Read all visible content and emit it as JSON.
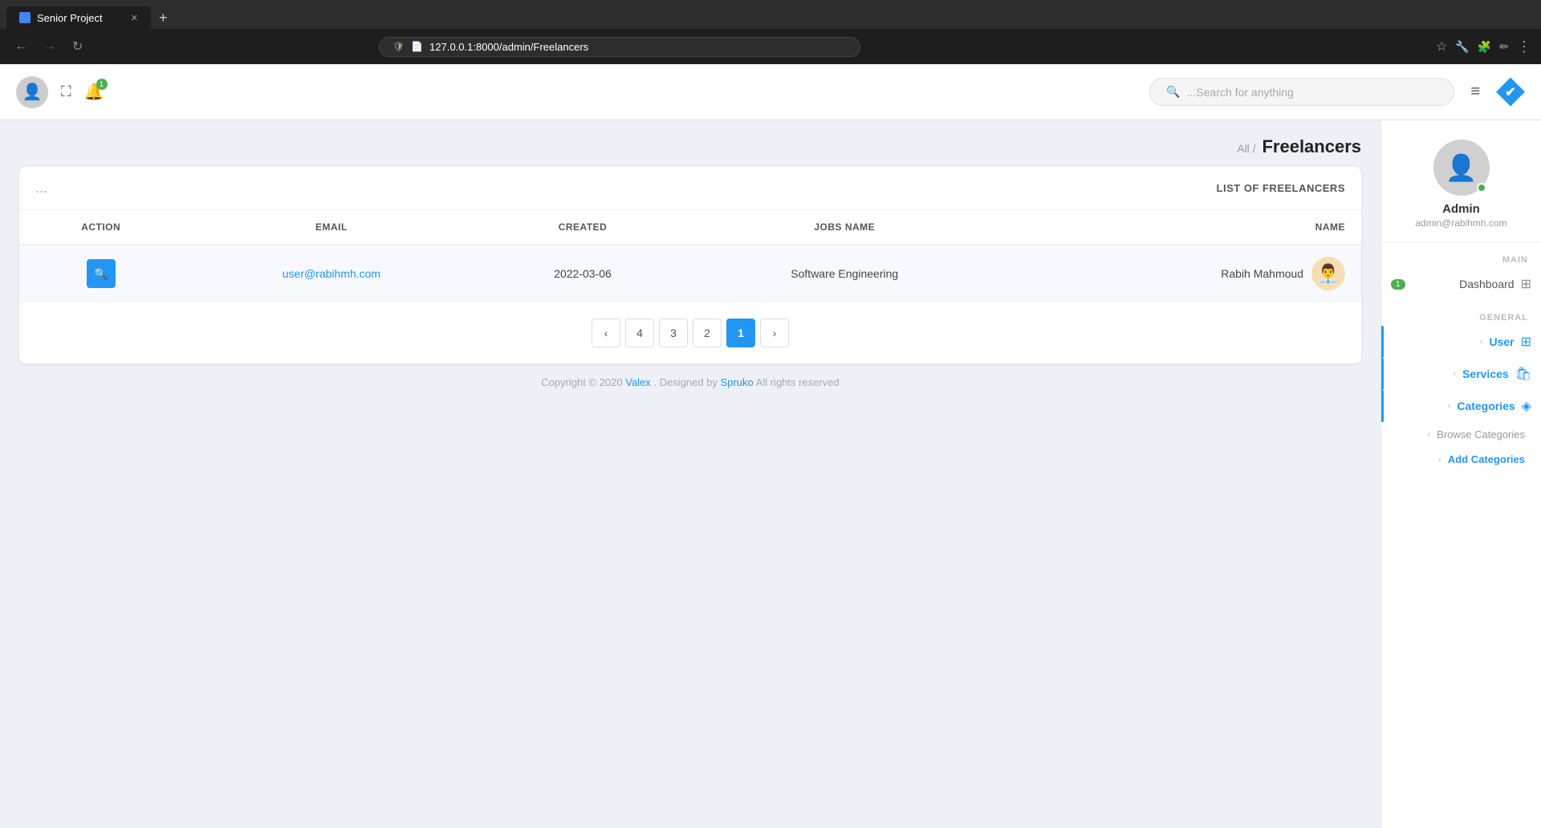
{
  "browser": {
    "tab_title": "Senior Project",
    "tab_favicon": "◆",
    "address": "127.0.0.1:8000/admin/Freelancers",
    "new_tab_label": "+"
  },
  "header": {
    "search_placeholder": "...Search for anything",
    "bell_badge": "1",
    "menu_icon": "≡"
  },
  "breadcrumb": {
    "all_label": "All /",
    "page_title": "Freelancers"
  },
  "table": {
    "card_title": "LIST OF FREELANCERS",
    "dots": "...",
    "columns": {
      "action": "ACTION",
      "email": "EMAIL",
      "created": "CREATED",
      "jobs_name": "JOBS NAME",
      "name": "NAME"
    },
    "rows": [
      {
        "email": "user@rabihmh.com",
        "created": "2022-03-06",
        "jobs_name": "Software Engineering",
        "name": "Rabih Mahmoud",
        "avatar_emoji": "👨‍💼"
      }
    ]
  },
  "pagination": {
    "prev": "‹",
    "next": "›",
    "pages": [
      "4",
      "3",
      "2",
      "1"
    ],
    "active_page": "1"
  },
  "sidebar": {
    "profile": {
      "name": "Admin",
      "email": "admin@rabihmh.com"
    },
    "main_label": "MAIN",
    "general_label": "GENERAL",
    "items": {
      "dashboard": {
        "label": "Dashboard",
        "badge": "1"
      },
      "user": {
        "label": "User"
      },
      "services": {
        "label": "Services"
      },
      "categories": {
        "label": "Categories"
      }
    },
    "sub_items": {
      "browse_categories": "Browse Categories",
      "add_categories": "Add Categories"
    }
  },
  "footer": {
    "text": "Copyright © 2020",
    "valex": "Valex",
    "middle": ". Designed by",
    "spruko": "Spruko",
    "end": "All rights reserved"
  }
}
